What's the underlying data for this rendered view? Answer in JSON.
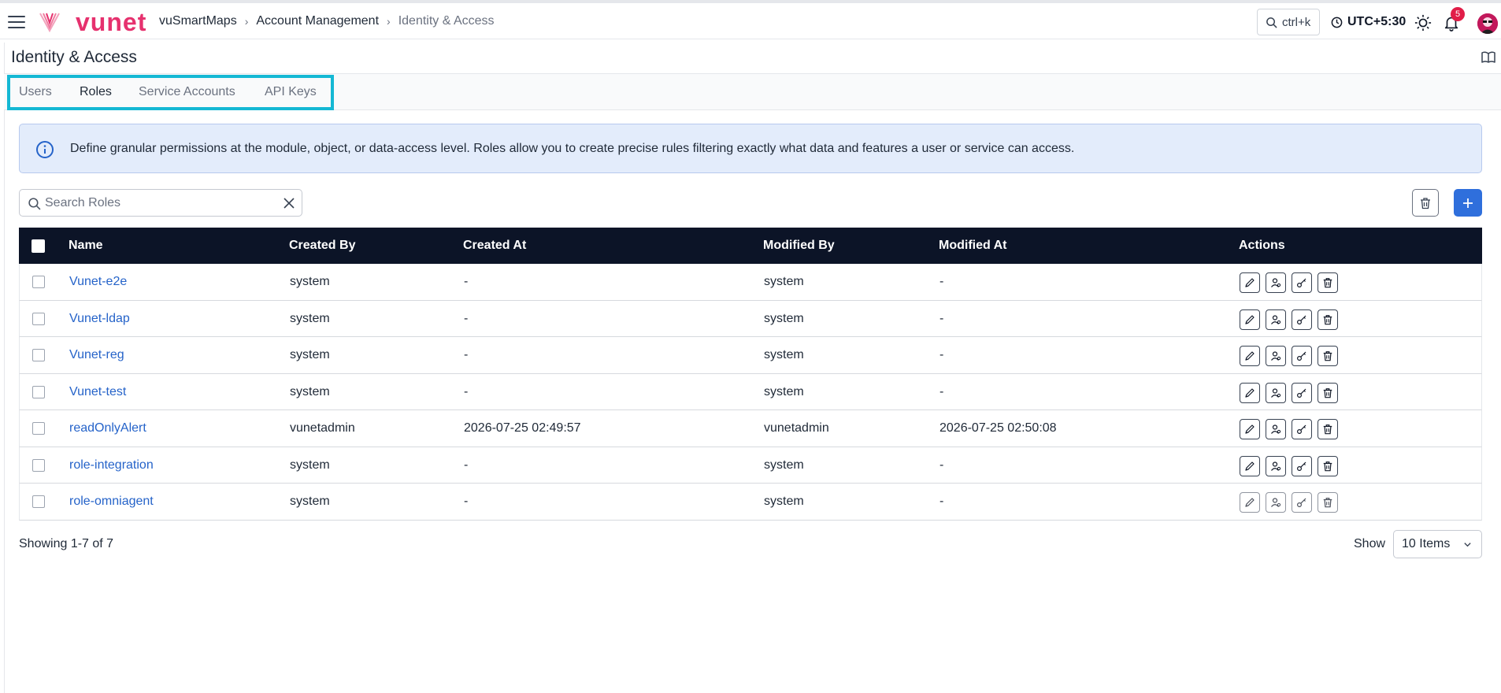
{
  "header": {
    "logo_text": "vunet",
    "breadcrumb": [
      "vuSmartMaps",
      "Account Management",
      "Identity & Access"
    ],
    "search_shortcut": "ctrl+k",
    "timezone": "UTC+5:30",
    "notification_count": "5",
    "icons": [
      "menu-icon",
      "search-icon",
      "clock-icon",
      "sun-icon",
      "bell-icon",
      "avatar"
    ]
  },
  "page": {
    "title": "Identity & Access"
  },
  "tabs": [
    {
      "label": "Users",
      "active": false
    },
    {
      "label": "Roles",
      "active": true
    },
    {
      "label": "Service Accounts",
      "active": false
    },
    {
      "label": "API Keys",
      "active": false
    }
  ],
  "info": {
    "text": "Define granular permissions at the module, object, or data-access level. Roles allow you to create precise rules filtering exactly what data and features a user or service can access."
  },
  "search": {
    "placeholder": "Search Roles",
    "value": ""
  },
  "table": {
    "columns": [
      "Name",
      "Created By",
      "Created At",
      "Modified By",
      "Modified At",
      "Actions"
    ],
    "rows": [
      {
        "name": "Vunet-e2e",
        "created_by": "system",
        "created_at": "-",
        "modified_by": "system",
        "modified_at": "-"
      },
      {
        "name": "Vunet-ldap",
        "created_by": "system",
        "created_at": "-",
        "modified_by": "system",
        "modified_at": "-"
      },
      {
        "name": "Vunet-reg",
        "created_by": "system",
        "created_at": "-",
        "modified_by": "system",
        "modified_at": "-"
      },
      {
        "name": "Vunet-test",
        "created_by": "system",
        "created_at": "-",
        "modified_by": "system",
        "modified_at": "-"
      },
      {
        "name": "readOnlyAlert",
        "created_by": "vunetadmin",
        "created_at": "2026-07-25 02:49:57",
        "modified_by": "vunetadmin",
        "modified_at": "2026-07-25 02:50:08"
      },
      {
        "name": "role-integration",
        "created_by": "system",
        "created_at": "-",
        "modified_by": "system",
        "modified_at": "-"
      },
      {
        "name": "role-omniagent",
        "created_by": "system",
        "created_at": "-",
        "modified_by": "system",
        "modified_at": "-"
      }
    ]
  },
  "footer": {
    "showing": "Showing 1-7 of 7",
    "show_label": "Show",
    "page_size": "10 Items"
  },
  "colors": {
    "brand": "#e6316e",
    "accent": "#2f6fdc",
    "header_bg": "#0c1427",
    "link": "#2563c9",
    "info_bg": "#e3ecfb",
    "tab_highlight": "#14b8d4"
  }
}
